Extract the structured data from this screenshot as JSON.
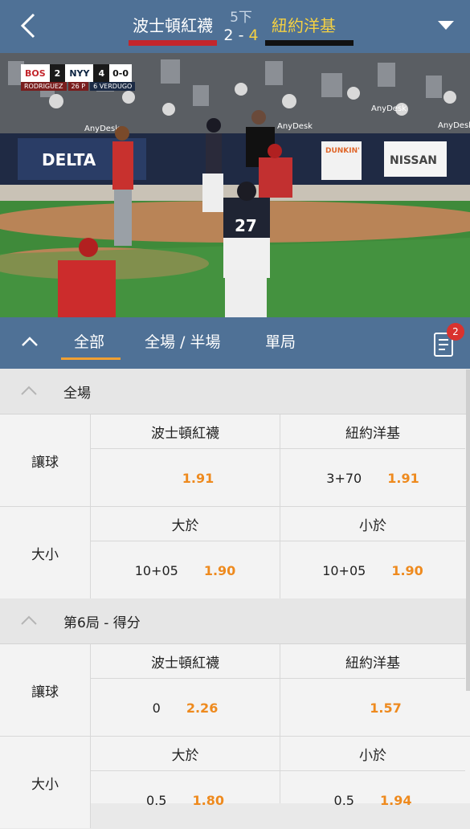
{
  "header": {
    "home_team": "波士頓紅襪",
    "away_team": "紐約洋基",
    "inning": "5下",
    "home_score": "2",
    "separator": "-",
    "away_score": "4",
    "home_color": "#c3262c",
    "away_color": "#f5d142",
    "back_icon": "chevron-left-icon",
    "menu_icon": "caret-down-icon"
  },
  "video": {
    "scorebug": {
      "home_abbr": "BOS",
      "home_runs": "2",
      "away_abbr": "NYY",
      "away_runs": "4",
      "outs_text": "0-0",
      "pitcher": "RODRIGUEZ",
      "pitch_count": "26 P",
      "batter": "6 VERDUGO"
    },
    "jersey_number": "27",
    "sign_delta": "DELTA",
    "sign_nissan": "NISSAN",
    "sign_dunkin": "DUNKIN'",
    "overlay_anydesk": "AnyDesk"
  },
  "tabs": {
    "items": [
      "全部",
      "全場 / 半場",
      "單局"
    ],
    "active": "全部",
    "badge": "2",
    "accent": "#f0a032"
  },
  "sections": [
    {
      "title": "全場",
      "markets": [
        {
          "label": "讓球",
          "col_a": {
            "head": "波士頓紅襪",
            "line": "",
            "price": "1.91"
          },
          "col_b": {
            "head": "紐約洋基",
            "line": "3+70",
            "price": "1.91"
          }
        },
        {
          "label": "大小",
          "col_a": {
            "head": "大於",
            "line": "10+05",
            "price": "1.90"
          },
          "col_b": {
            "head": "小於",
            "line": "10+05",
            "price": "1.90"
          }
        }
      ]
    },
    {
      "title": "第6局 - 得分",
      "markets": [
        {
          "label": "讓球",
          "col_a": {
            "head": "波士頓紅襪",
            "line": "0",
            "price": "2.26"
          },
          "col_b": {
            "head": "紐約洋基",
            "line": "",
            "price": "1.57"
          }
        },
        {
          "label": "大小",
          "col_a": {
            "head": "大於",
            "line": "0.5",
            "price": "1.80"
          },
          "col_b": {
            "head": "小於",
            "line": "0.5",
            "price": "1.94"
          }
        }
      ]
    }
  ]
}
